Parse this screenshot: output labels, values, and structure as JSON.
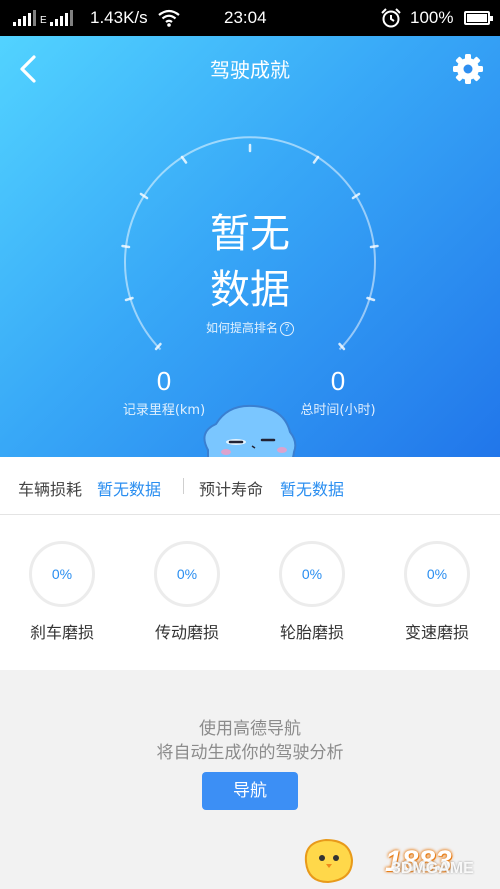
{
  "status_bar": {
    "network_speed": "1.43K/s",
    "time": "23:04",
    "battery": "100%",
    "network_type": "E"
  },
  "header": {
    "title": "驾驶成就",
    "back_icon": "chevron-left-icon",
    "settings_icon": "gear-icon"
  },
  "gauge": {
    "line1": "暂无",
    "line2": "数据",
    "rank_link": "如何提高排名",
    "rank_help": "?"
  },
  "stats": [
    {
      "value": "0",
      "label": "记录里程(km)"
    },
    {
      "value": "0",
      "label": "总时间(小时)"
    }
  ],
  "vehicle": {
    "wear_label": "车辆损耗",
    "wear_value": "暂无数据",
    "life_label": "预计寿命",
    "life_value": "暂无数据"
  },
  "wear_items": [
    {
      "percent": "0%",
      "label": "刹车磨损"
    },
    {
      "percent": "0%",
      "label": "传动磨损"
    },
    {
      "percent": "0%",
      "label": "轮胎磨损"
    },
    {
      "percent": "0%",
      "label": "变速磨损"
    }
  ],
  "footer": {
    "tip_line1": "使用高德导航",
    "tip_line2": "将自动生成你的驾驶分析",
    "nav_button": "导航"
  },
  "watermark": {
    "logo": "1883",
    "site": "3DMGAME"
  },
  "colors": {
    "gradient_start": "#52d3ff",
    "gradient_end": "#2176ea",
    "accent_blue": "#2a8ef0",
    "button_blue": "#3c8ff5"
  }
}
